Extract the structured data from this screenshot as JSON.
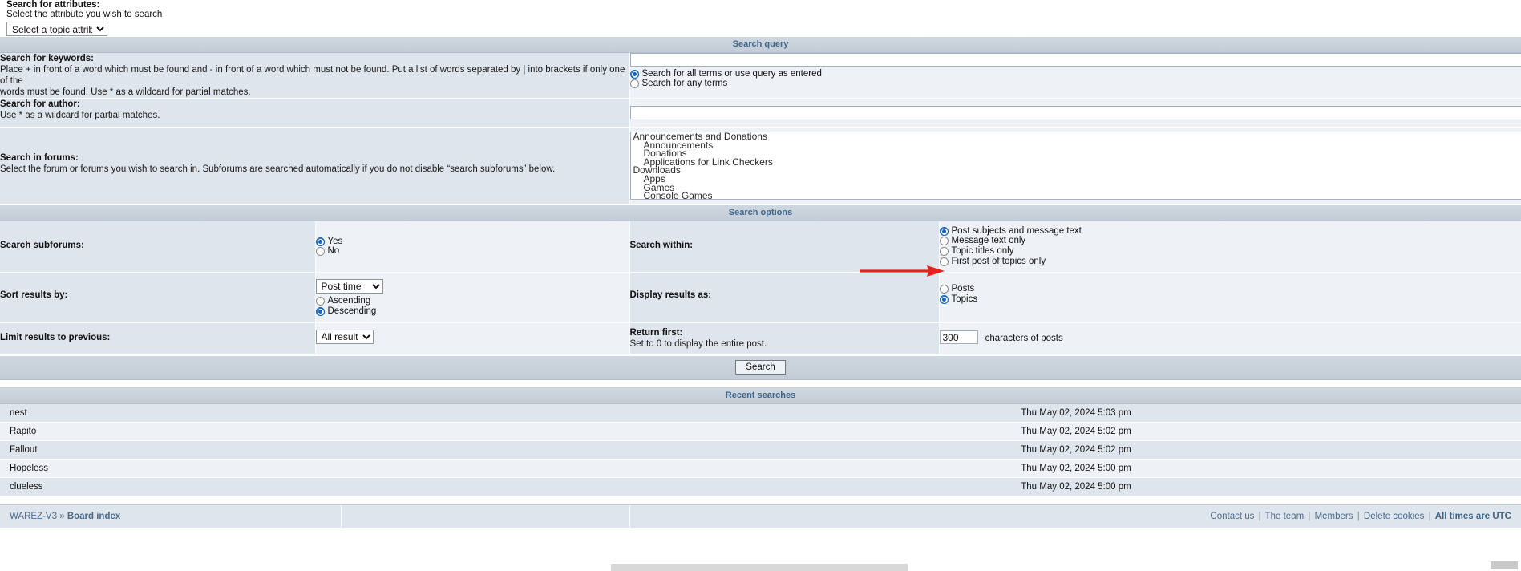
{
  "attribute_block": {
    "title": "Search for attributes:",
    "subtitle": "Select the attribute you wish to search",
    "select_value": "Select a topic attribute"
  },
  "sections": {
    "search_query": "Search query",
    "search_options": "Search options",
    "recent_searches": "Recent searches"
  },
  "keywords": {
    "label": "Search for keywords:",
    "desc_line1": "Place + in front of a word which must be found and - in front of a word which must not be found. Put a list of words separated by | into brackets if only one of the",
    "desc_line2": "words must be found. Use * as a wildcard for partial matches.",
    "value": "",
    "options": [
      {
        "label": "Search for all terms or use query as entered",
        "selected": true
      },
      {
        "label": "Search for any terms",
        "selected": false
      }
    ]
  },
  "author": {
    "label": "Search for author:",
    "desc": "Use * as a wildcard for partial matches.",
    "value": ""
  },
  "forums": {
    "label": "Search in forums:",
    "desc": "Select the forum or forums you wish to search in. Subforums are searched automatically if you do not disable “search subforums” below.",
    "options": [
      {
        "label": "Announcements and Donations",
        "indent": false
      },
      {
        "label": "Announcements",
        "indent": true
      },
      {
        "label": "Donations",
        "indent": true
      },
      {
        "label": "Applications for Link Checkers",
        "indent": true
      },
      {
        "label": "Downloads",
        "indent": false
      },
      {
        "label": "Apps",
        "indent": true
      },
      {
        "label": "Games",
        "indent": true
      },
      {
        "label": "Console Games",
        "indent": true
      }
    ]
  },
  "subforums": {
    "label": "Search subforums:",
    "options": [
      {
        "label": "Yes",
        "selected": true
      },
      {
        "label": "No",
        "selected": false
      }
    ]
  },
  "search_within": {
    "label": "Search within:",
    "options": [
      {
        "label": "Post subjects and message text",
        "selected": true
      },
      {
        "label": "Message text only",
        "selected": false
      },
      {
        "label": "Topic titles only",
        "selected": false
      },
      {
        "label": "First post of topics only",
        "selected": false
      }
    ]
  },
  "sort_results": {
    "label": "Sort results by:",
    "select_value": "Post time",
    "options": [
      {
        "label": "Ascending",
        "selected": false
      },
      {
        "label": "Descending",
        "selected": true
      }
    ]
  },
  "display_results": {
    "label": "Display results as:",
    "options": [
      {
        "label": "Posts",
        "selected": false
      },
      {
        "label": "Topics",
        "selected": true
      }
    ]
  },
  "limit_results": {
    "label": "Limit results to previous:",
    "select_value": "All results"
  },
  "return_first": {
    "label": "Return first:",
    "desc": "Set to 0 to display the entire post.",
    "value": "300",
    "suffix": "characters of posts"
  },
  "submit": {
    "label": "Search"
  },
  "recent_searches": [
    {
      "keywords": "nest",
      "time": "Thu May 02, 2024 5:03 pm"
    },
    {
      "keywords": "Rapito",
      "time": "Thu May 02, 2024 5:02 pm"
    },
    {
      "keywords": "Fallout",
      "time": "Thu May 02, 2024 5:02 pm"
    },
    {
      "keywords": "Hopeless",
      "time": "Thu May 02, 2024 5:00 pm"
    },
    {
      "keywords": "clueless",
      "time": "Thu May 02, 2024 5:00 pm"
    }
  ],
  "footer": {
    "board_name": "WAREZ-V3",
    "separator": "»",
    "board_index": "Board index",
    "contact_us": "Contact us",
    "the_team": "The team",
    "members": "Members",
    "delete_cookies": "Delete cookies",
    "timezone": "All times are UTC",
    "pipe": "|"
  },
  "annotation": {
    "color": "#e8201f"
  }
}
